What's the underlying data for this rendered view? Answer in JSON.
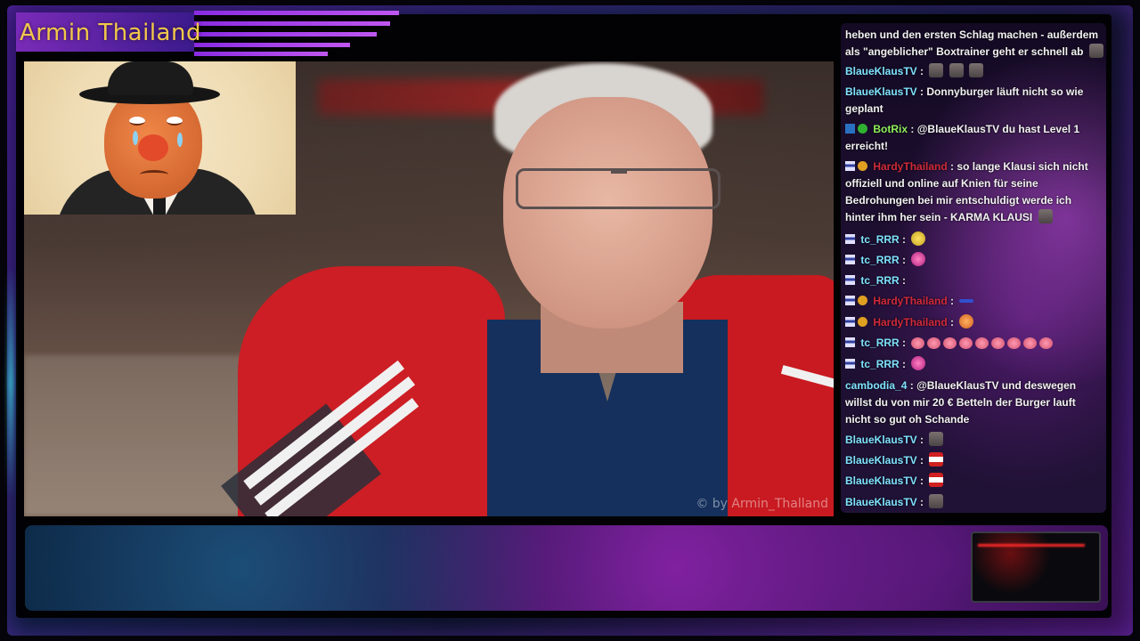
{
  "title": "Armin Thailand",
  "watermark": "© by Armin_Thalland",
  "chat": {
    "messages": [
      {
        "user": "",
        "text": "heben und den ersten Schlag machen - außerdem als \"angeblicher\" Boxtrainer geht er schnell ab"
      },
      {
        "user": "BlaueKlausTV",
        "text": ""
      },
      {
        "user": "BlaueKlausTV",
        "text": "Donnyburger läuft nicht so wie geplant"
      },
      {
        "user": "BotRix",
        "text": "@BlaueKlausTV du hast Level 1 erreicht!"
      },
      {
        "user": "HardyThailand",
        "text": "so lange Klausi sich nicht offiziell und online auf Knien für seine Bedrohungen bei mir entschuldigt werde ich hinter ihm her sein - KARMA KLAUSI"
      },
      {
        "user": "tc_RRR",
        "text": ""
      },
      {
        "user": "tc_RRR",
        "text": ""
      },
      {
        "user": "tc_RRR",
        "text": ""
      },
      {
        "user": "HardyThailand",
        "text": ""
      },
      {
        "user": "HardyThailand",
        "text": ""
      },
      {
        "user": "tc_RRR",
        "text": ""
      },
      {
        "user": "tc_RRR",
        "text": ""
      },
      {
        "user": "cambodia_4",
        "text": "@BlaueKlausTV und deswegen willst du von mir 20 € Betteln der Burger lauft nicht so gut oh Schande"
      },
      {
        "user": "BlaueKlausTV",
        "text": ""
      },
      {
        "user": "BlaueKlausTV",
        "text": ""
      },
      {
        "user": "BlaueKlausTV",
        "text": ""
      },
      {
        "user": "BlaueKlausTV",
        "text": ""
      }
    ],
    "colon": ":"
  },
  "colors": {
    "title": "#f2c84a",
    "user_default": "#7fe2ff",
    "user_bot": "#8ff05a",
    "user_red": "#d02a3a"
  }
}
